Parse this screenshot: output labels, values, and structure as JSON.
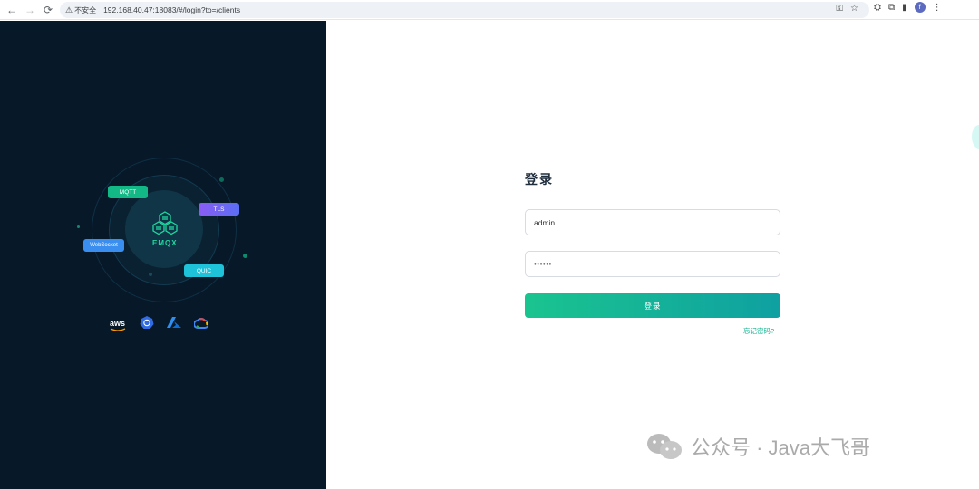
{
  "browser": {
    "security_label": "不安全",
    "url": "192.168.40.47:18083/#/login?to=/clients",
    "profile_initial": "f"
  },
  "hero": {
    "product": "EMQX",
    "tags": {
      "mqtt": "MQTT",
      "tls": "TLS",
      "websocket": "WebSocket",
      "quic": "QUIC"
    },
    "brand_aws": "aws"
  },
  "login": {
    "title": "登录",
    "username_value": "admin",
    "password_value": "••••••",
    "submit_label": "登录",
    "forgot_label": "忘记密码?"
  },
  "watermark": {
    "text": "公众号 · Java大飞哥"
  },
  "colors": {
    "left_bg": "#071829",
    "accent": "#13b38f"
  }
}
